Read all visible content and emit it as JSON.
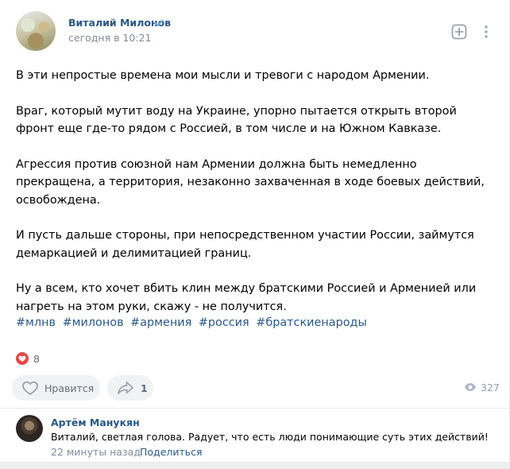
{
  "post": {
    "author_name": "Виталий Милонов",
    "time": "сегодня в 10:21",
    "paragraphs": [
      "В эти непростые времена мои мысли и тревоги с народом Армении.",
      "Враг, который мутит воду на Украине, упорно пытается открыть второй фронт еще где-то рядом с Россией, в том числе и на Южном Кавказе.",
      "Агрессия против союзной нам Армении должна быть немедленно прекращена, а территория, незаконно захваченная в ходе боевых действий, освобождена.",
      "И пусть дальше стороны, при непосредственном участии  России, займутся демаркацией и делимитацией границ.",
      "Ну а всем, кто хочет вбить клин между братскими Россией и Арменией или нагреть на этом руки, скажу - не  получится."
    ],
    "hashtags": [
      "#млнв",
      "#милонов",
      "#армения",
      "#россия",
      "#братскиенароды"
    ],
    "reaction_count": "8",
    "like_label": "Нравится",
    "share_count": "1",
    "views_count": "327"
  },
  "comment": {
    "author_name": "Артём Манукян",
    "text": "Виталий, светлая голова. Радует, что есть люди понимающие суть этих действий!",
    "time": "22 минуты назад",
    "share_label": "Поделиться"
  },
  "icons": {
    "verified": "verified-check-icon",
    "add": "add-square-icon",
    "more": "more-vertical-icon",
    "heart": "heart-icon",
    "share": "share-arrow-icon",
    "views": "eye-icon"
  },
  "colors": {
    "link": "#2a5885",
    "secondary_text": "#818c99",
    "reaction": "#e64646",
    "button_bg": "#f0f2f5"
  }
}
